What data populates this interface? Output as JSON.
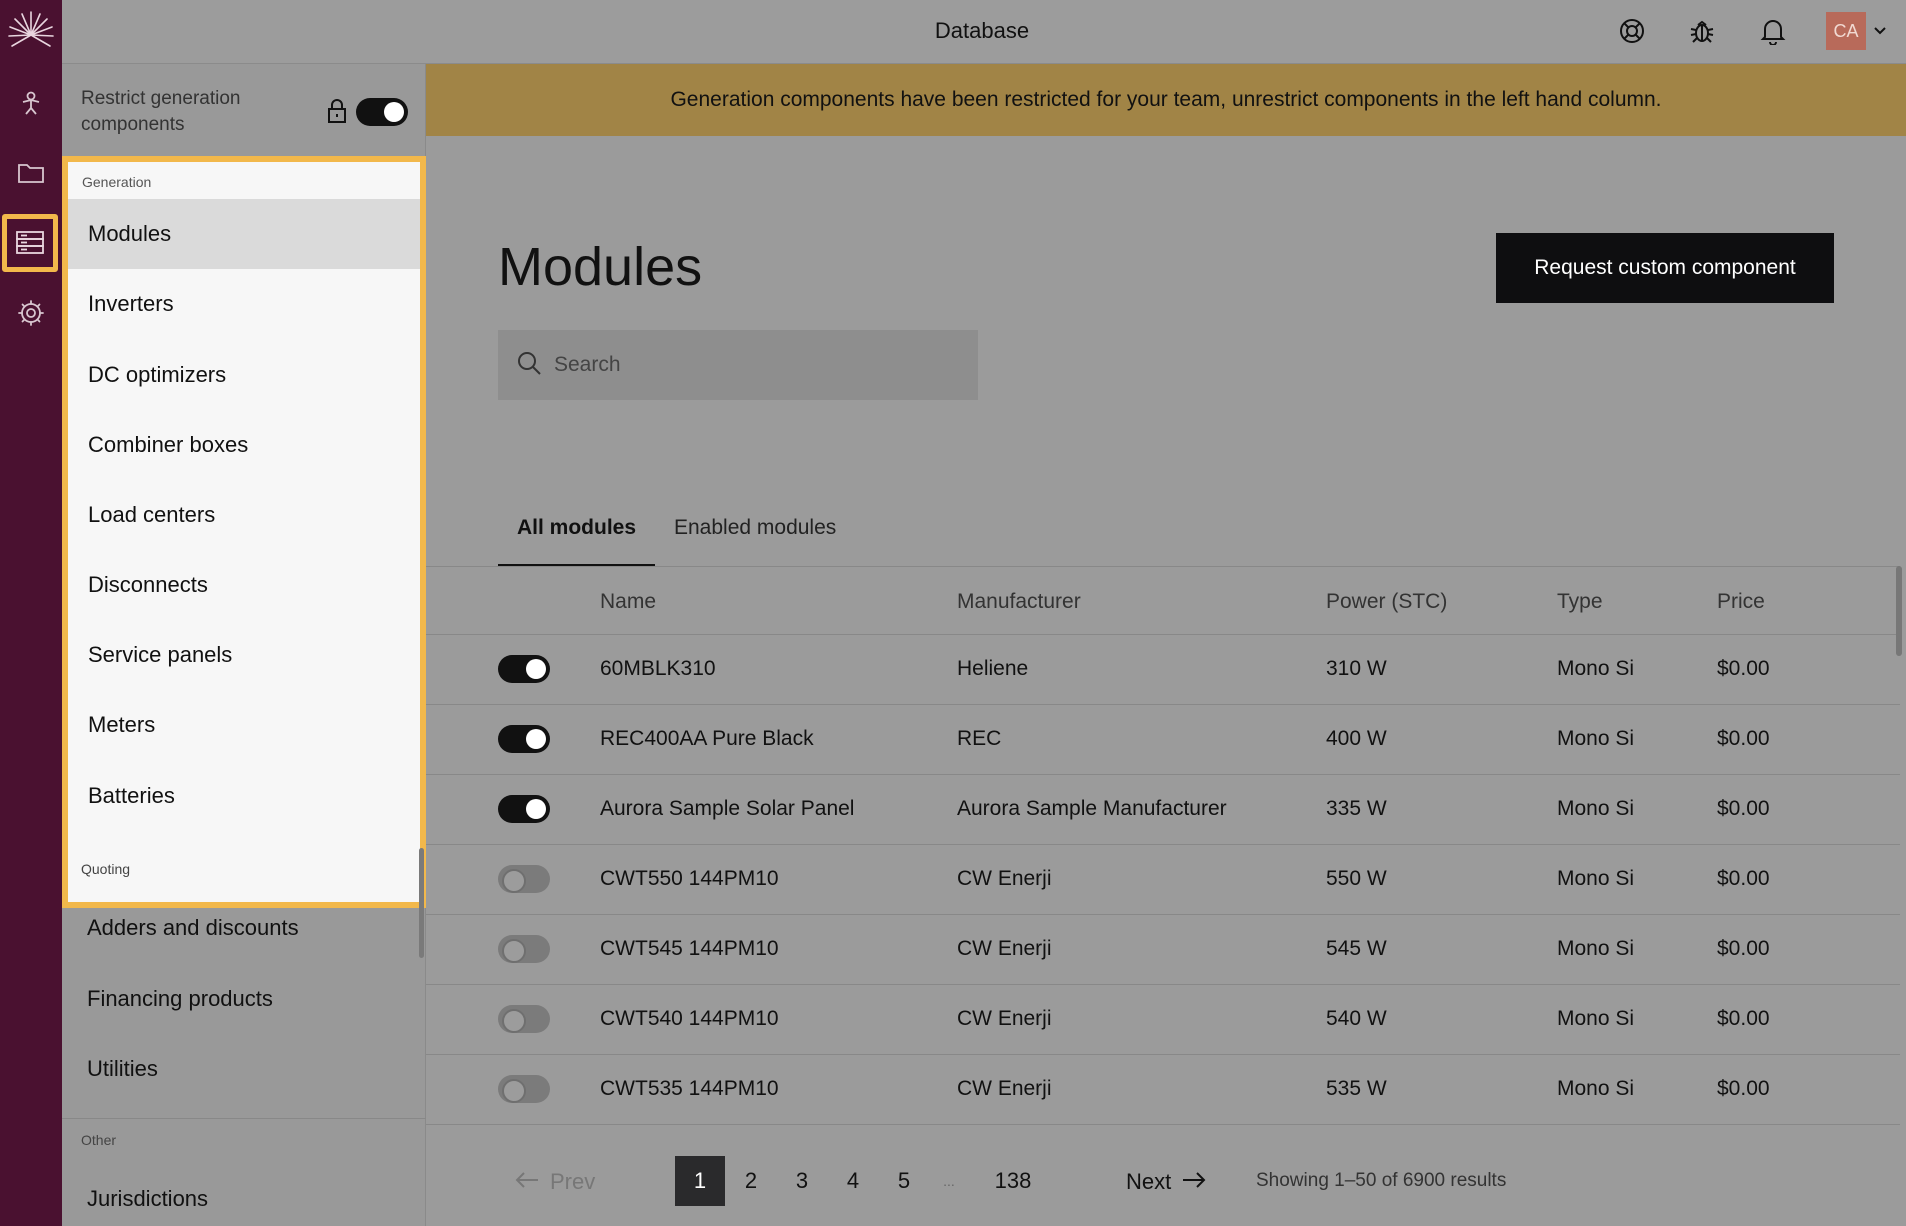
{
  "topbar": {
    "title": "Database",
    "avatar_initials": "CA",
    "icons": [
      "lifebuoy-icon",
      "bug-icon",
      "bell-icon"
    ]
  },
  "rail": {
    "items": [
      "logo-icon",
      "person-icon",
      "folder-icon",
      "database-icon",
      "gear-icon"
    ]
  },
  "sidebar": {
    "restrict_label": "Restrict generation components",
    "restrict_enabled": true,
    "generation_label": "Generation",
    "generation_items": [
      {
        "label": "Modules",
        "selected": true
      },
      {
        "label": "Inverters"
      },
      {
        "label": "DC optimizers"
      },
      {
        "label": "Combiner boxes"
      },
      {
        "label": "Load centers"
      },
      {
        "label": "Disconnects"
      },
      {
        "label": "Service panels"
      },
      {
        "label": "Meters"
      },
      {
        "label": "Batteries"
      }
    ],
    "quoting_label": "Quoting",
    "quoting_items": [
      {
        "label": "Adders and discounts"
      },
      {
        "label": "Financing products"
      },
      {
        "label": "Utilities"
      }
    ],
    "other_label": "Other",
    "other_items": [
      {
        "label": "Jurisdictions"
      }
    ]
  },
  "main": {
    "banner": "Generation components have been restricted for your team, unrestrict components in the left hand column.",
    "title": "Modules",
    "request_button": "Request custom component",
    "search_placeholder": "Search",
    "tabs": [
      {
        "label": "All modules",
        "active": true
      },
      {
        "label": "Enabled modules"
      }
    ],
    "columns": [
      "Name",
      "Manufacturer",
      "Power (STC)",
      "Type",
      "Price"
    ],
    "rows": [
      {
        "enabled": true,
        "name": "60MBLK310",
        "manufacturer": "Heliene",
        "power": "310 W",
        "type": "Mono Si",
        "price": "$0.00"
      },
      {
        "enabled": true,
        "name": "REC400AA Pure Black",
        "manufacturer": "REC",
        "power": "400 W",
        "type": "Mono Si",
        "price": "$0.00"
      },
      {
        "enabled": true,
        "name": "Aurora Sample Solar Panel",
        "manufacturer": "Aurora Sample Manufacturer",
        "power": "335 W",
        "type": "Mono Si",
        "price": "$0.00"
      },
      {
        "enabled": false,
        "name": "CWT550 144PM10",
        "manufacturer": "CW Enerji",
        "power": "550 W",
        "type": "Mono Si",
        "price": "$0.00"
      },
      {
        "enabled": false,
        "name": "CWT545 144PM10",
        "manufacturer": "CW Enerji",
        "power": "545 W",
        "type": "Mono Si",
        "price": "$0.00"
      },
      {
        "enabled": false,
        "name": "CWT540 144PM10",
        "manufacturer": "CW Enerji",
        "power": "540 W",
        "type": "Mono Si",
        "price": "$0.00"
      },
      {
        "enabled": false,
        "name": "CWT535 144PM10",
        "manufacturer": "CW Enerji",
        "power": "535 W",
        "type": "Mono Si",
        "price": "$0.00"
      }
    ],
    "pagination": {
      "prev": "Prev",
      "next": "Next",
      "pages": [
        "1",
        "2",
        "3",
        "4",
        "5",
        "...",
        "138"
      ],
      "current": "1",
      "showing": "Showing 1–50 of 6900 results"
    }
  },
  "colors": {
    "rail": "#4a1130",
    "highlight": "#f2b84b",
    "banner": "#a18446",
    "button": "#0e0e10"
  }
}
